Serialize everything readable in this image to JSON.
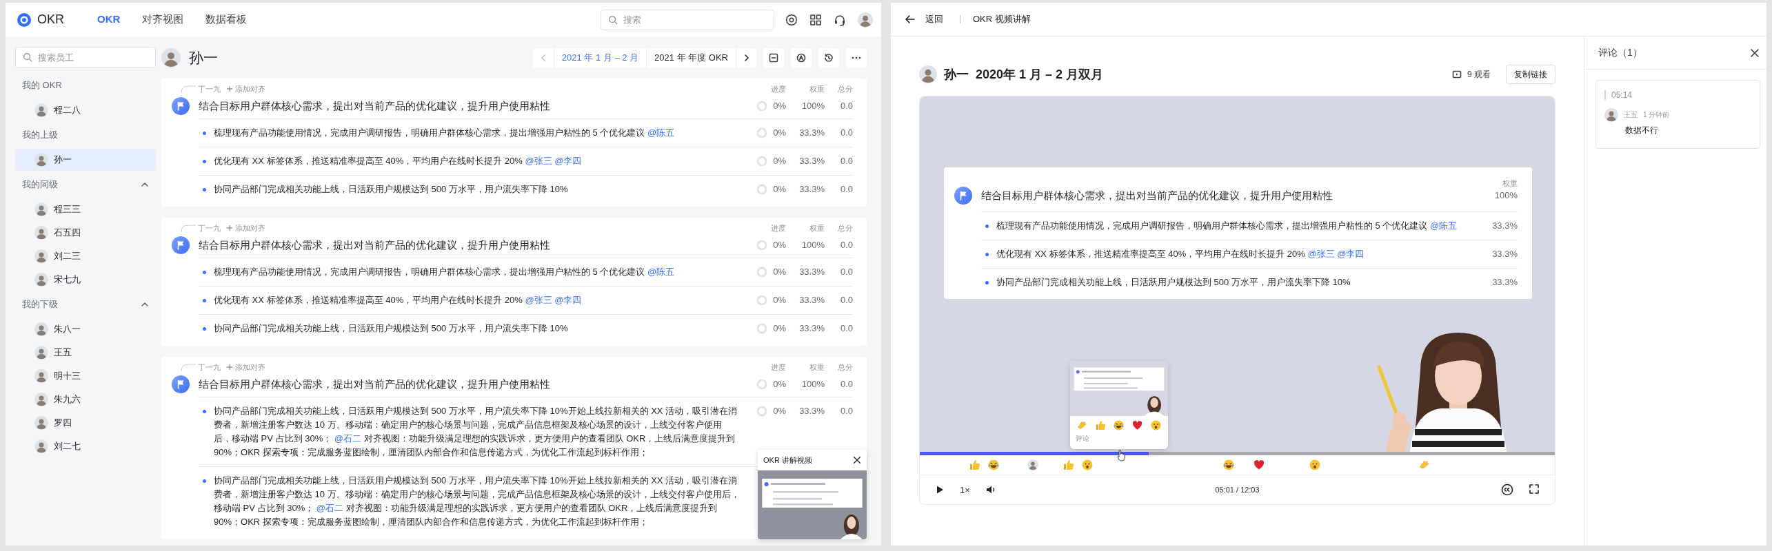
{
  "left_window": {
    "logo": "OKR",
    "nav_tabs": [
      {
        "label": "OKR",
        "selected": true
      },
      {
        "label": "对齐视图",
        "selected": false
      },
      {
        "label": "数据看板",
        "selected": false
      }
    ],
    "search": {
      "placeholder": "搜索"
    },
    "sidebar": {
      "search": {
        "placeholder": "搜索员工"
      },
      "sections": [
        {
          "title": "我的 OKR",
          "kind": "fixed",
          "people": [
            {
              "name": "程二八",
              "selected": false
            }
          ]
        },
        {
          "title": "我的上级",
          "kind": "fixed",
          "people": [
            {
              "name": "孙一",
              "selected": true
            }
          ]
        },
        {
          "title": "我的同级",
          "kind": "collapsible",
          "expanded": true,
          "people": [
            {
              "name": "程三三",
              "selected": false
            },
            {
              "name": "石五四",
              "selected": false
            },
            {
              "name": "刘二三",
              "selected": false
            },
            {
              "name": "宋七九",
              "selected": false
            }
          ]
        },
        {
          "title": "我的下级",
          "kind": "collapsible",
          "expanded": true,
          "people": [
            {
              "name": "朱八一",
              "selected": false
            },
            {
              "name": "王五",
              "selected": false
            },
            {
              "name": "明十三",
              "selected": false
            },
            {
              "name": "朱九六",
              "selected": false
            },
            {
              "name": "罗四",
              "selected": false
            },
            {
              "name": "刘二七",
              "selected": false
            }
          ]
        }
      ]
    },
    "owner": {
      "name": "孙一"
    },
    "periods": [
      {
        "label": "2021 年 1 月 – 2 月",
        "selected": true
      },
      {
        "label": "2021 年 年度 OKR",
        "selected": false
      }
    ],
    "cards": [
      {
        "parent": "丁一九",
        "add_align": "添加对齐",
        "columns": [
          "进度",
          "权重",
          "总分"
        ],
        "objective": {
          "title": "结合目标用户群体核心需求，提出对当前产品的优化建议，提升用户使用粘性",
          "progress": "0%",
          "weight": "100%",
          "score": "0.0"
        },
        "key_results": [
          {
            "segments": [
              {
                "kind": "text",
                "text": "梳理现有产品功能使用情况，完成用户调研报告，明确用户群体核心需求，提出增强用户粘性的 5 个优化建议"
              },
              {
                "kind": "mention",
                "text": "@陈五"
              }
            ],
            "progress": "0%",
            "weight": "33.3%",
            "score": "0.0"
          },
          {
            "segments": [
              {
                "kind": "text",
                "text": "优化现有 XX 标签体系，推送精准率提高至 40%，平均用户在线时长提升 20%"
              },
              {
                "kind": "mention",
                "text": "@张三"
              },
              {
                "kind": "mention",
                "text": "@李四"
              }
            ],
            "progress": "0%",
            "weight": "33.3%",
            "score": "0.0"
          },
          {
            "segments": [
              {
                "kind": "text",
                "text": "协同产品部门完成相关功能上线，日活跃用户规模达到 500 万水平，用户流失率下降 10%"
              }
            ],
            "progress": "0%",
            "weight": "33.3%",
            "score": "0.0"
          }
        ]
      },
      {
        "parent": "丁一九",
        "add_align": "添加对齐",
        "columns": [
          "进度",
          "权重",
          "总分"
        ],
        "objective": {
          "title": "结合目标用户群体核心需求，提出对当前产品的优化建议，提升用户使用粘性",
          "progress": "0%",
          "weight": "100%",
          "score": "0.0"
        },
        "key_results": [
          {
            "segments": [
              {
                "kind": "text",
                "text": "梳理现有产品功能使用情况，完成用户调研报告，明确用户群体核心需求，提出增强用户粘性的 5 个优化建议"
              },
              {
                "kind": "mention",
                "text": "@陈五"
              }
            ],
            "progress": "0%",
            "weight": "33.3%",
            "score": "0.0"
          },
          {
            "segments": [
              {
                "kind": "text",
                "text": "优化现有 XX 标签体系，推送精准率提高至 40%，平均用户在线时长提升 20%"
              },
              {
                "kind": "mention",
                "text": "@张三"
              },
              {
                "kind": "mention",
                "text": "@李四"
              }
            ],
            "progress": "0%",
            "weight": "33.3%",
            "score": "0.0"
          },
          {
            "segments": [
              {
                "kind": "text",
                "text": "协同产品部门完成相关功能上线，日活跃用户规模达到 500 万水平，用户流失率下降 10%"
              }
            ],
            "progress": "0%",
            "weight": "33.3%",
            "score": "0.0"
          }
        ]
      },
      {
        "parent": "丁一九",
        "add_align": "添加对齐",
        "columns": [
          "进度",
          "权重",
          "总分"
        ],
        "objective": {
          "title": "结合目标用户群体核心需求，提出对当前产品的优化建议，提升用户使用粘性",
          "progress": "0%",
          "weight": "100%",
          "score": "0.0"
        },
        "key_results": [
          {
            "segments": [
              {
                "kind": "text",
                "text": "协同产品部门完成相关功能上线，日活跃用户规模达到 500 万水平，用户流失率下降 10%开始上线拉新相关的 XX 活动，吸引潜在消费者，新增注册客户数达 10 万。移动端：确定用户的核心场景与问题，完成产品信息框架及核心场景的设计，上线交付客户使用后，移动端 PV 占比到 30%；"
              },
              {
                "kind": "mention",
                "text": "@石二"
              },
              {
                "kind": "text",
                "text": "对齐视图：功能升级满足理想的实践诉求，更方便用户的查看团队 OKR，上线后满意度提升到 90%；OKR 探索专项：完成服务蓝图绘制，厘清团队内部合作和信息传递方式，为优化工作流起到标杆作用；"
              }
            ],
            "progress": "0%",
            "weight": "33.3%",
            "score": "0.0"
          },
          {
            "segments": [
              {
                "kind": "text",
                "text": "协同产品部门完成相关功能上线，日活跃用户规模达到 500 万水平，用户流失率下降 10%开始上线拉新相关的 XX 活动，吸引潜在消费者，新增注册客户数达 10 万。移动端：确定用户的核心场景与问题，完成产品信息框架及核心场景的设计，上线交付客户使用后，移动端 PV 占比到 30%；"
              },
              {
                "kind": "mention",
                "text": "@石二"
              },
              {
                "kind": "text",
                "text": "对齐视图：功能升级满足理想的实践诉求，更方便用户的查看团队 OKR，上线后满意度提升到 90%；OKR 探索专项：完成服务蓝图绘制，厘清团队内部合作和信息传递方式，为优化工作流起到标杆作用；"
              }
            ]
          }
        ]
      }
    ],
    "video_popup": {
      "title": "OKR 讲解视频"
    }
  },
  "right_window": {
    "back": "返回",
    "title": "OKR 视频讲解",
    "video_header": {
      "name": "孙一",
      "period": "2020年 1 月 – 2 月双月",
      "views": "9 观看",
      "copy_button": "复制链接"
    },
    "video": {
      "slide": {
        "column": "权重",
        "objective": {
          "title": "结合目标用户群体核心需求，提出对当前产品的优化建议，提升用户使用粘性",
          "weight": "100%"
        },
        "key_results": [
          {
            "segments": [
              {
                "kind": "text",
                "text": "梳理现有产品功能使用情况，完成用户调研报告，明确用户群体核心需求，提出增强用户粘性的 5 个优化建议"
              },
              {
                "kind": "mention",
                "text": "@陈五"
              }
            ],
            "weight": "33.3%"
          },
          {
            "segments": [
              {
                "kind": "text",
                "text": "优化现有 XX 标签体系，推送精准率提高至 40%，平均用户在线时长提升 20%"
              },
              {
                "kind": "mention",
                "text": "@张三"
              },
              {
                "kind": "mention",
                "text": "@李四"
              }
            ],
            "weight": "33.3%"
          },
          {
            "segments": [
              {
                "kind": "text",
                "text": "协同产品部门完成相关功能上线，日活跃用户规模达到 500 万水平，用户流失率下降 10%"
              }
            ],
            "weight": "33.3%"
          }
        ]
      },
      "hover_preview": {
        "reactions": [
          {
            "kind": "clap"
          },
          {
            "kind": "thumbs-up"
          },
          {
            "kind": "laugh"
          },
          {
            "kind": "heart"
          },
          {
            "kind": "wow"
          }
        ],
        "comment_field": {
          "placeholder": "评论"
        }
      },
      "progress": {
        "level": 0.36
      },
      "reactions": [
        {
          "kind": "thumbs-up"
        },
        {
          "kind": "laugh"
        },
        {
          "kind": "avatar"
        },
        {
          "kind": "thumbs-up"
        },
        {
          "kind": "wow"
        },
        {
          "kind": "laugh"
        },
        {
          "kind": "heart"
        },
        {
          "kind": "wow"
        },
        {
          "kind": "clap"
        }
      ],
      "speed": "1×",
      "time": "05:01 / 12:03"
    },
    "comments": {
      "title": "评论（1）",
      "items": [
        {
          "timestamp": "05:14",
          "author": "王五",
          "time": "1 分钟前",
          "text": "数据不行"
        }
      ]
    }
  }
}
